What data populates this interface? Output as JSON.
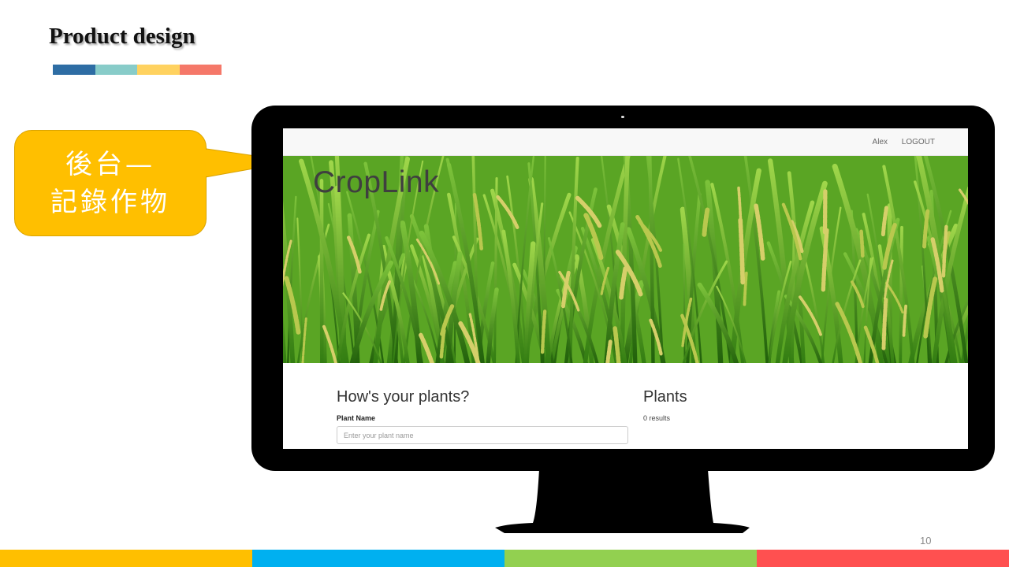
{
  "slide": {
    "title": "Product design",
    "page_number": "10",
    "title_bar_colors": [
      "#2e6da4",
      "#88ccc9",
      "#ffd260",
      "#f57869"
    ],
    "footer_colors": [
      "#ffbf00",
      "#00b0f0",
      "#92d050",
      "#ff5050"
    ]
  },
  "callout": {
    "line1": "後台—",
    "line2": "記錄作物",
    "color": "#ffbf00"
  },
  "app": {
    "navbar": {
      "user": "Alex",
      "logout": "LOGOUT"
    },
    "hero": {
      "brand": "CropLink",
      "image_icon": "rice-field-image"
    },
    "form": {
      "heading": "How's your plants?",
      "plant_name_label": "Plant Name",
      "plant_name_placeholder": "Enter your plant name",
      "plant_name_value": ""
    },
    "plants": {
      "heading": "Plants",
      "results": "0 results"
    }
  }
}
